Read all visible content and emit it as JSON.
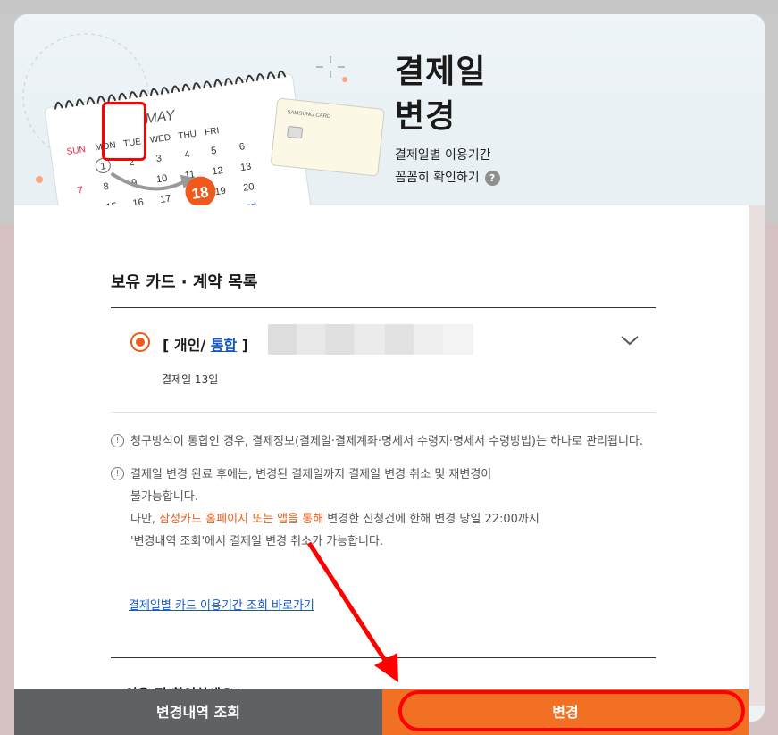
{
  "hero": {
    "title_line1": "결제일",
    "title_line2": "변경",
    "desc_line1": "결제일별 이용기간",
    "desc_line2": "꼼꼼히 확인하기",
    "help_icon": "?",
    "calendar": {
      "month": "MAY",
      "days": [
        "SUN",
        "MON",
        "TUE",
        "WED",
        "THU",
        "FRI"
      ],
      "highlight_day": "18",
      "circled_day": "1",
      "card_brand": "SAMSUNG CARD"
    }
  },
  "cards": {
    "section_title": "보유 카드 · 계약 목록",
    "item": {
      "prefix": "[ 개인/ ",
      "link": "통합",
      "suffix": " ]",
      "pay_day": "결제일 13일"
    }
  },
  "notices": [
    {
      "text": "청구방식이 통합인 경우, 결제정보(결제일·결제계좌·명세서 수령지·명세서 수령방법)는 하나로 관리됩니다."
    },
    {
      "line1": "결제일 변경 완료 후에는, 변경된 결제일까지 결제일 변경 취소 및 재변경이",
      "line2": "불가능합니다.",
      "line3_pre": "다만, ",
      "line3_accent": "삼성카드 홈페이지 또는 앱을 통해",
      "line3_post": " 변경한 신청건에 한해 변경 당일 22:00까지",
      "line4": "'변경내역 조회'에서 결제일 변경 취소가 가능합니다."
    }
  ],
  "link_text": "결제일별 카드 이용기간 조회 바로가기",
  "check_title": "이용 전 확인하세요!",
  "buttons": {
    "history": "변경내역 조회",
    "change": "변경"
  },
  "colors": {
    "accent": "#f27024",
    "link": "#1257c4",
    "annotation": "#ff0000"
  }
}
